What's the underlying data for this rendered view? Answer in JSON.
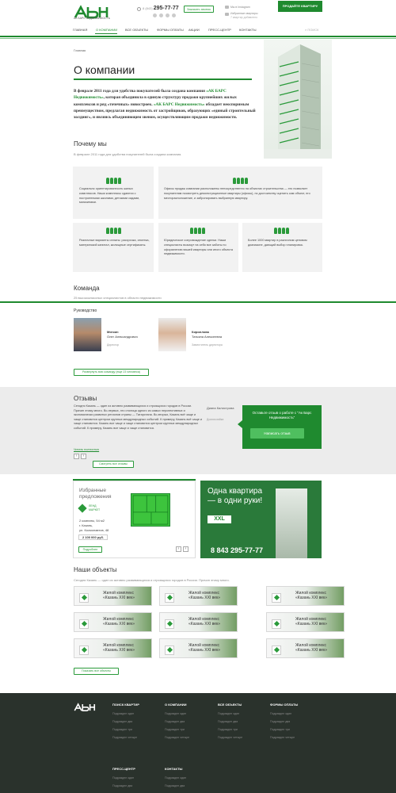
{
  "header": {
    "logo_text": "АБН",
    "logo_sub": "АК БАРС НЕДВИЖИМОСТЬ",
    "phone_prefix": "8 (843)",
    "phone": "295-77-77",
    "call_button": "Заказать звонок",
    "link_1": "Мы в Instagram",
    "link_2": "Избранные квартиры",
    "link_2_sub": "7 квартир добавлено",
    "sell_button": "ПРОДАЙТЕ КВАРТИРУ"
  },
  "nav": {
    "items": [
      "ГЛАВНАЯ",
      "О КОМПАНИИ",
      "ВСЕ ОБЪЕКТЫ",
      "ФОРМЫ ОПЛАТЫ",
      "АКЦИИ",
      "ПРЕСС-ЦЕНТР",
      "КОНТАКТЫ"
    ],
    "search": "ПОИСК"
  },
  "breadcrumb": "Главная",
  "page_title": "О компании",
  "intro": {
    "part1": "В феврале 2011 года для удобства покупателей была создана компания ",
    "link1": "«АК БАРС Недвижимость»",
    "part2": ", которая объединила в единую структуру продажи крупнейших жилых комплексов и ряд «точечных» новостроек. ",
    "link2": "«АК БАРС Недвижимость»",
    "part3": " обладает неоспоримым преимуществом, предлагая недвижимость от застройщиков, образующих «единый строительный холдинг», и являясь объединяющим звеном, осуществляющим продажи недвижимости."
  },
  "why": {
    "title": "Почему мы",
    "subtitle": "В феврале 2011 года для удобства покупателей была создана компания.",
    "features": [
      "Социально ориентированность жилых комплексов. Наши комплексы сдаются с построенными школами, детскими садами, магазинами.",
      "Офисы продаж компании расположены непосредственно на объектах строительства — это позволяет покупателям посмотреть демонстрационные квартиры (офисы), по достоинству оценить сам объект, его месторасположение, и забронировать выбранную квартиру.",
      "Различные варианты оплаты: рассрочка, ипотека, материнский капитал, жилищные сертификаты.",
      "Юридическое сопровождение сделки. Наши специалисты возьмут на себя все заботы по оформлению вашей квартиры или иного объекта недвижимости.",
      "Более 1000 квартир в различном ценовом диапазоне, дающий выбор планировок."
    ]
  },
  "team": {
    "title": "Команда",
    "subtitle": "25 высококлассных специалистов в области недвижимости",
    "section": "Руководство",
    "members": [
      {
        "name": "Мяткин",
        "fullname": "Олег Александрович",
        "role": "Директор"
      },
      {
        "name": "Кириллова",
        "fullname": "Татьяна Алексеевна",
        "role": "Заместитель директора"
      }
    ],
    "expand_button": "Развернуть всю команду (еще 23 человека)"
  },
  "reviews": {
    "title": "Отзывы",
    "text": "Сегодня Казань — один из активно развивающихся и строящихся городов в России. Причин этому много. Во-первых, это столица одного из самых перспективных и экономически развитых регионов страны — Татарстана. Во-вторых, Казань всё чаще и чаще становится центром крупных международных событий. К примеру, Казань всё чаще и чаще становится. Казань все чаще и чаще становится центром крупных международных событий. К примеру, Казань все чаще и чаще становится.",
    "read_more": "Читать полностью",
    "author": "Диана Калистрова",
    "author_role": "Домохозяйка",
    "cta": "Оставьте отзыв о работе с \"Ак Барс Недвижимость\"",
    "cta_button": "Написать отзыв",
    "all_button": "Смотреть все отзывы",
    "prev": "‹",
    "next": "›"
  },
  "offers": {
    "title": "Избранные предложения",
    "brand": "ЛЕНД МАРКЕТ",
    "rooms": "2 комнаты, 54 м2",
    "city": "г. Казань,",
    "address": "ул. Космонавтов, 48",
    "price": "2 100 000 руб.",
    "more": "Подробнее",
    "prev": "‹",
    "next": "›"
  },
  "ad": {
    "title": "Одна квартира — в одни руки!",
    "badge": "XXL",
    "phone": "8 843 295-77-77"
  },
  "objects": {
    "title": "Наши объекты",
    "subtitle": "Сегодня Казань — один из активно развивающихся и строящихся городов в России. Причин этому много.",
    "cards": [
      {
        "l1": "Жилой комплекс",
        "l2": "«Казань XXI век»",
        "logo": "ЛЕНД МАРКЕТ"
      },
      {
        "l1": "Жилой комплекс",
        "l2": "«Казань XXI век»",
        "logo": "ЛЕНД МАРКЕТ"
      },
      {
        "l1": "Жилой комплекс",
        "l2": "«Казань XXI век»",
        "logo": "ЛЕНД МАРКЕТ"
      },
      {
        "l1": "Жилой комплекс",
        "l2": "«Казань XXI век»",
        "logo": "ЛЕНД МАРКЕТ"
      },
      {
        "l1": "Жилой комплекс",
        "l2": "«Казань XXI век»",
        "logo": "ЛЕНД МАРКЕТ"
      },
      {
        "l1": "Жилой комплекс",
        "l2": "«Казань XXI век»",
        "logo": "ЛЕНД МАРКЕТ"
      },
      {
        "l1": "Жилой комплекс",
        "l2": "«Казань XXI век»",
        "logo": "ЛЕНД МАРКЕТ"
      },
      {
        "l1": "Жилой комплекс",
        "l2": "«Казань XXI век»",
        "logo": "ЛЕНД МАРКЕТ"
      },
      {
        "l1": "Жилой комплекс",
        "l2": "«Казань XXI век»",
        "logo": "ЛЕНД МАРКЕТ"
      }
    ],
    "show_all": "Показать все объекты"
  },
  "footer": {
    "columns": [
      {
        "title": "ПОИСК КВАРТИР",
        "items": [
          "Подраздел один",
          "Подраздел два",
          "Подраздел три",
          "Подраздел четыре"
        ]
      },
      {
        "title": "О КОМПАНИИ",
        "items": [
          "Подраздел один",
          "Подраздел два",
          "Подраздел три",
          "Подраздел четыре"
        ]
      },
      {
        "title": "ВСЕ ОБЪЕКТЫ",
        "items": [
          "Подраздел один",
          "Подраздел два",
          "Подраздел три",
          "Подраздел четыре"
        ]
      },
      {
        "title": "ФОРМЫ ОПЛАТЫ",
        "items": [
          "Подраздел один",
          "Подраздел два",
          "Подраздел три",
          "Подраздел четыре"
        ]
      },
      {
        "title": "ПРЕСС-ЦЕНТР",
        "items": [
          "Подраздел один",
          "Подраздел два"
        ]
      },
      {
        "title": "КОНТАКТЫ",
        "items": [
          "Подраздел один",
          "Подраздел два"
        ]
      }
    ]
  },
  "colors": {
    "brand_green": "#1f8a2f",
    "light_green": "#4fbf5f",
    "footer_bg": "#2a322c"
  }
}
